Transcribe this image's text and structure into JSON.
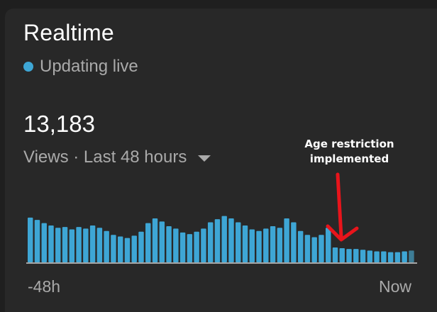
{
  "header": {
    "title": "Realtime",
    "status_text": "Updating live",
    "status_color": "#3ea6d5"
  },
  "metric": {
    "value": "13,183",
    "range_label": "Views · Last 48 hours"
  },
  "annotation": {
    "text_line1": "Age restriction",
    "text_line2": "implemented",
    "arrow_color": "#e8141b"
  },
  "chart_data": {
    "type": "bar",
    "title": "",
    "xlabel": "",
    "ylabel": "",
    "x_tick_labels": [
      "-48h",
      "Now"
    ],
    "bar_color": "#3ea6d5",
    "current_bar_color": "#3d7d96",
    "values": [
      57,
      54,
      50,
      47,
      44,
      45,
      42,
      45,
      43,
      47,
      44,
      40,
      35,
      33,
      31,
      34,
      39,
      50,
      56,
      52,
      46,
      43,
      38,
      36,
      39,
      43,
      51,
      55,
      59,
      56,
      51,
      47,
      42,
      40,
      43,
      46,
      44,
      56,
      51,
      40,
      35,
      32,
      35,
      44,
      19,
      18,
      17,
      17,
      16,
      15,
      14,
      14,
      13,
      13,
      14,
      15
    ],
    "ylim": [
      0,
      65
    ]
  }
}
